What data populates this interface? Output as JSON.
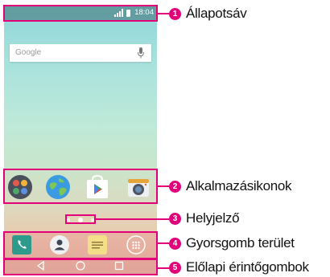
{
  "status_bar": {
    "time": "18:04"
  },
  "search_widget": {
    "placeholder": "Google"
  },
  "apps": [
    {
      "icon": "apps-folder-icon"
    },
    {
      "icon": "globe-browser-icon"
    },
    {
      "icon": "play-store-icon"
    },
    {
      "icon": "camera-icon"
    }
  ],
  "page_indicator": {
    "dots": 3,
    "active": 2
  },
  "quick_keys": [
    {
      "icon": "phone-icon"
    },
    {
      "icon": "contacts-icon"
    },
    {
      "icon": "messages-icon"
    },
    {
      "icon": "app-drawer-icon"
    }
  ],
  "nav_buttons": [
    {
      "icon": "back-icon"
    },
    {
      "icon": "home-icon"
    },
    {
      "icon": "recent-apps-icon"
    }
  ],
  "callouts": [
    {
      "number": "1",
      "label": "Állapotsáv"
    },
    {
      "number": "2",
      "label": "Alkalmazásikonok"
    },
    {
      "number": "3",
      "label": "Helyjelző"
    },
    {
      "number": "4",
      "label": "Gyorsgomb terület"
    },
    {
      "number": "5",
      "label": "Előlapi érintőgombok"
    }
  ],
  "colors": {
    "accent": "#e2007a"
  }
}
